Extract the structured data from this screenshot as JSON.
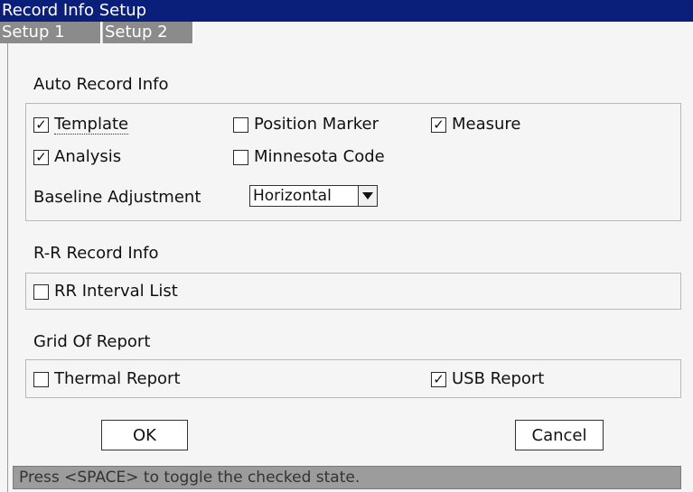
{
  "window": {
    "title": "Record Info Setup"
  },
  "tabs": [
    {
      "label": "Setup 1",
      "selected": false
    },
    {
      "label": "Setup 2",
      "selected": true
    }
  ],
  "auto_record": {
    "title": "Auto Record Info",
    "checkboxes": {
      "template": {
        "label": "Template",
        "checked": true
      },
      "position_marker": {
        "label": "Position Marker",
        "checked": false
      },
      "measure": {
        "label": "Measure",
        "checked": true
      },
      "analysis": {
        "label": "Analysis",
        "checked": true
      },
      "minnesota_code": {
        "label": "Minnesota Code",
        "checked": false
      }
    },
    "baseline": {
      "label": "Baseline Adjustment",
      "value": "Horizontal"
    }
  },
  "rr_record": {
    "title": "R-R Record Info",
    "rr_interval": {
      "label": "RR Interval List",
      "checked": false
    }
  },
  "grid_report": {
    "title": "Grid Of Report",
    "thermal": {
      "label": "Thermal Report",
      "checked": false
    },
    "usb": {
      "label": "USB Report",
      "checked": true
    }
  },
  "buttons": {
    "ok": "OK",
    "cancel": "Cancel"
  },
  "status": {
    "text": "Press <SPACE> to toggle the checked state."
  },
  "colors": {
    "titlebar": "#0a1f7a",
    "tab": "#8b8b8b",
    "statusbar": "#9c9c9c"
  },
  "icons": {
    "check": "check-icon",
    "dropdown": "triangle-down-icon"
  }
}
